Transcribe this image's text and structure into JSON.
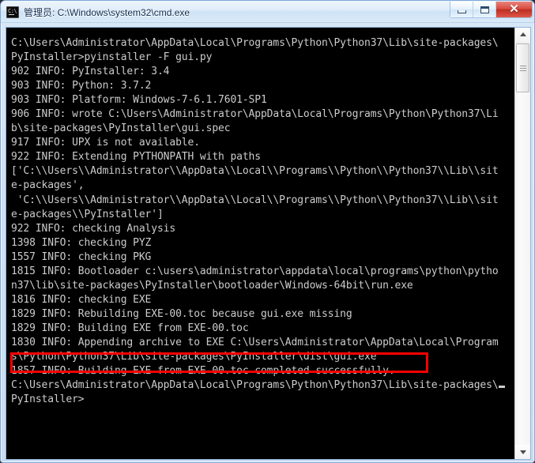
{
  "window": {
    "title": "管理员: C:\\Windows\\system32\\cmd.exe",
    "icon": "cmd-icon",
    "buttons": {
      "minimize": "minimize-button",
      "maximize": "maximize-button",
      "close_label": "✕"
    }
  },
  "console": {
    "lines": [
      "C:\\Users\\Administrator\\AppData\\Local\\Programs\\Python\\Python37\\Lib\\site-packages\\",
      "PyInstaller>pyinstaller -F gui.py",
      "902 INFO: PyInstaller: 3.4",
      "903 INFO: Python: 3.7.2",
      "903 INFO: Platform: Windows-7-6.1.7601-SP1",
      "906 INFO: wrote C:\\Users\\Administrator\\AppData\\Local\\Programs\\Python\\Python37\\Li",
      "b\\site-packages\\PyInstaller\\gui.spec",
      "917 INFO: UPX is not available.",
      "922 INFO: Extending PYTHONPATH with paths",
      "['C:\\\\Users\\\\Administrator\\\\AppData\\\\Local\\\\Programs\\\\Python\\\\Python37\\\\Lib\\\\sit",
      "e-packages',",
      " 'C:\\\\Users\\\\Administrator\\\\AppData\\\\Local\\\\Programs\\\\Python\\\\Python37\\\\Lib\\\\sit",
      "e-packages\\\\PyInstaller']",
      "922 INFO: checking Analysis",
      "1398 INFO: checking PYZ",
      "1557 INFO: checking PKG",
      "1815 INFO: Bootloader c:\\users\\administrator\\appdata\\local\\programs\\python\\pytho",
      "n37\\lib\\site-packages\\PyInstaller\\bootloader\\Windows-64bit\\run.exe",
      "1816 INFO: checking EXE",
      "1829 INFO: Rebuilding EXE-00.toc because gui.exe missing",
      "1829 INFO: Building EXE from EXE-00.toc",
      "1830 INFO: Appending archive to EXE C:\\Users\\Administrator\\AppData\\Local\\Program",
      "s\\Python\\Python37\\Lib\\site-packages\\PyInstaller\\dist\\gui.exe",
      "1857 INFO: Building EXE from EXE-00.toc completed successfully.",
      "C:\\Users\\Administrator\\AppData\\Local\\Programs\\Python\\Python37\\Lib\\site-packages\\",
      "PyInstaller>"
    ],
    "highlighted_line_index": 22,
    "cursor_after_line_index": 24,
    "background_color": "#000000",
    "text_color": "#cccccc"
  },
  "annotation": {
    "type": "red-rectangle",
    "color": "#ff0000",
    "targets_text": "1857 INFO: Building EXE from EXE-00.toc completed successfully."
  },
  "scrollbar": {
    "up_arrow": "scroll-up-arrow",
    "down_arrow": "scroll-down-arrow",
    "thumb": "scroll-thumb"
  }
}
